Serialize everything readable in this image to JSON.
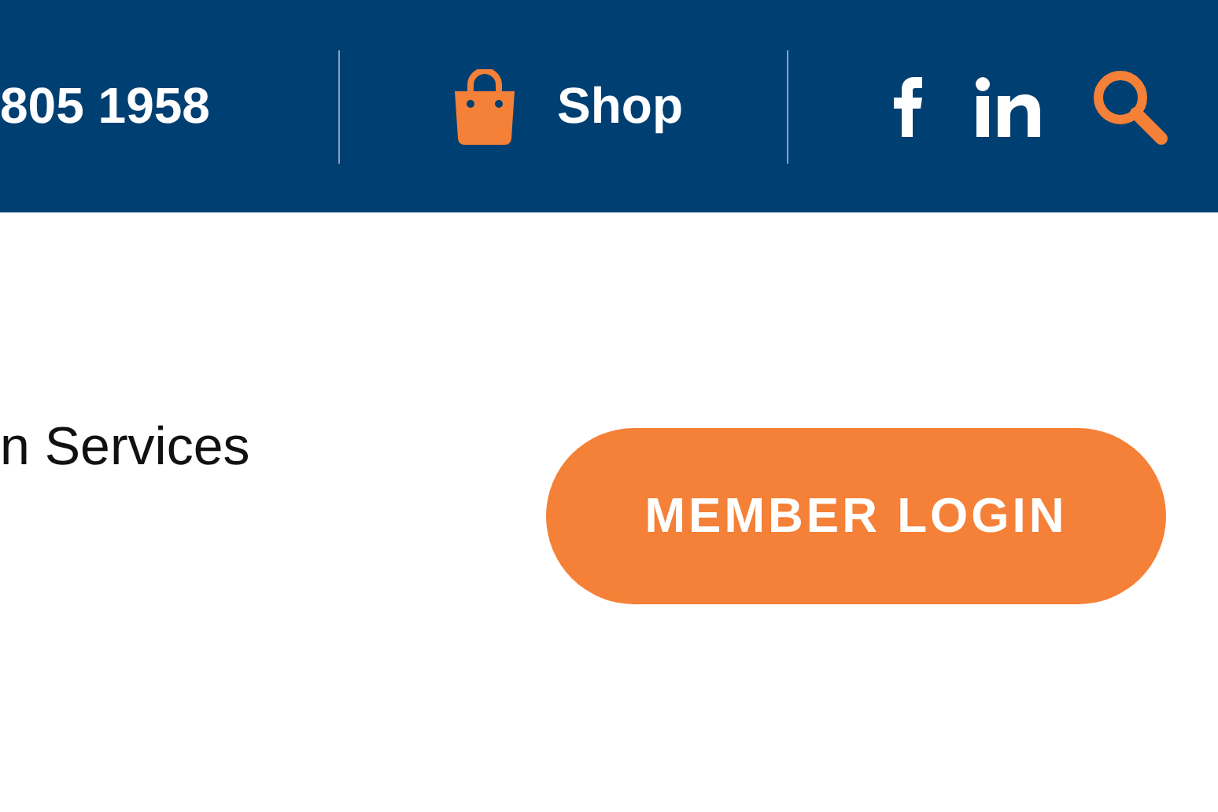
{
  "top_bar": {
    "phone": "805 1958",
    "shop_link": "Shop"
  },
  "nav": {
    "item": "n Services"
  },
  "login_button": "MEMBER LOGIN"
}
